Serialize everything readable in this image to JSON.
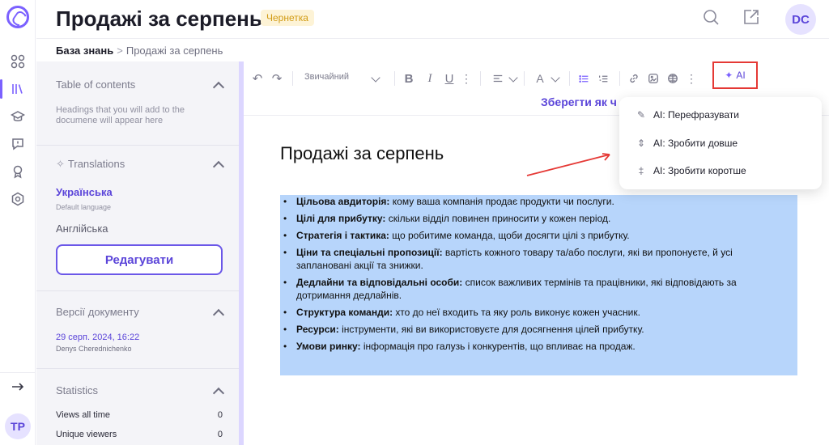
{
  "header": {
    "title": "Продажі за серпень",
    "status": "Чернетка",
    "user_initials": "DC"
  },
  "breadcrumb": {
    "root": "База знань",
    "separator": ">",
    "current": "Продажі за серпень"
  },
  "rail": {
    "user_initials": "TP",
    "items": [
      "grid-icon",
      "library-icon",
      "courses-icon",
      "feedback-icon",
      "achievement-icon",
      "settings-icon"
    ],
    "accent": "#7b61ff"
  },
  "sidebar": {
    "toc": {
      "title": "Table of contents",
      "hint": "Headings that you will add to the documene will appear here"
    },
    "translations": {
      "title": "Translations",
      "active_language": "Українська",
      "default_label": "Default language",
      "other_language": "Англійська",
      "edit_button": "Редагувати"
    },
    "versions": {
      "title": "Версії документу",
      "date": "29 серп. 2024, 16:22",
      "author": "Denys Cherednichenko"
    },
    "statistics": {
      "title": "Statistics",
      "rows": [
        {
          "label": "Views all time",
          "value": "0"
        },
        {
          "label": "Unique viewers",
          "value": "0"
        }
      ]
    }
  },
  "toolbar": {
    "text_style": "Звичайний",
    "ai_label": "AI",
    "save_as": "Зберегти як ч"
  },
  "ai_menu": {
    "items": [
      {
        "label": "AI: Перефразувати",
        "icon": "pencil-icon"
      },
      {
        "label": "AI: Зробити довше",
        "icon": "expand-icon"
      },
      {
        "label": "AI: Зробити коротше",
        "icon": "collapse-icon"
      }
    ]
  },
  "document": {
    "title": "Продажі за серпень",
    "bullets": [
      {
        "bold": "Цільова авдиторія:",
        "text": " кому ваша компанія продає продукти чи послуги."
      },
      {
        "bold": "Цілі для прибутку:",
        "text": " скільки відділ повинен приносити у кожен період."
      },
      {
        "bold": "Стратегія і тактика:",
        "text": " що робитиме команда, щоби досягти цілі з прибутку."
      },
      {
        "bold": "Ціни та спеціальні пропозиції:",
        "text": " вартість кожного товару та/або послуги, які ви пропонуєте, й усі заплановані акції та знижки."
      },
      {
        "bold": "Дедлайни та відповідальні особи:",
        "text": " список важливих термінів та працівники, які відповідають за дотримання дедлайнів."
      },
      {
        "bold": "Структура команди:",
        "text": " хто до неї входить та яку роль виконує кожен учасник."
      },
      {
        "bold": "Ресурси:",
        "text": " інструменти, які ви використовуєте для досягнення цілей прибутку."
      },
      {
        "bold": "Умови ринку:",
        "text": " інформація про галузь і конкурентів, що впливає на продаж."
      }
    ],
    "selection_color": "#b7d5fb"
  }
}
